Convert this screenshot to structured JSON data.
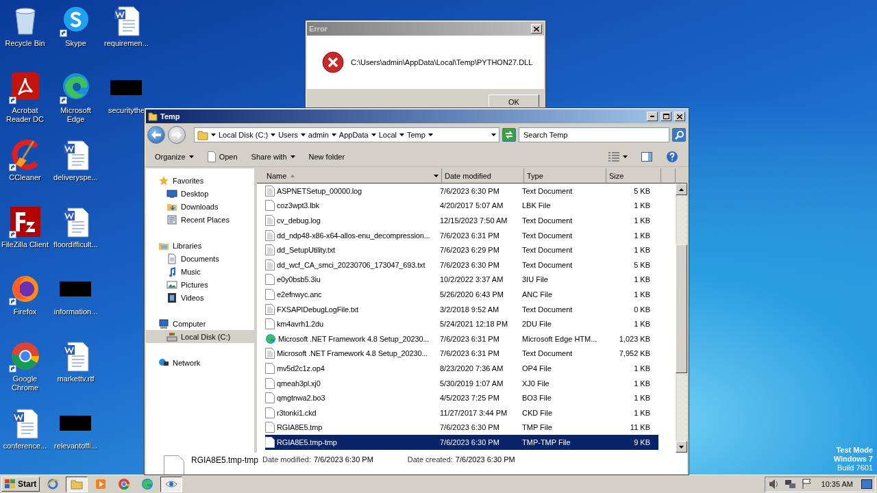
{
  "desktop_icons": [
    {
      "label": "Recycle Bin",
      "kind": "recycle",
      "shortcut": false
    },
    {
      "label": "Acrobat Reader DC",
      "kind": "acrobat",
      "shortcut": true
    },
    {
      "label": "CCleaner",
      "kind": "ccleaner",
      "shortcut": true
    },
    {
      "label": "FileZilla Client",
      "kind": "filezilla",
      "shortcut": true
    },
    {
      "label": "Firefox",
      "kind": "firefox",
      "shortcut": true
    },
    {
      "label": "Google Chrome",
      "kind": "chrome",
      "shortcut": true
    },
    {
      "label": "conference...",
      "kind": "word",
      "shortcut": false
    },
    {
      "label": "Skype",
      "kind": "skype",
      "shortcut": true
    },
    {
      "label": "Microsoft Edge",
      "kind": "edge",
      "shortcut": true
    },
    {
      "label": "deliveryspe...",
      "kind": "word",
      "shortcut": false
    },
    {
      "label": "floordifficult...",
      "kind": "word",
      "shortcut": false
    },
    {
      "label": "information...",
      "kind": "blackout",
      "shortcut": false
    },
    {
      "label": "markettv.rtf",
      "kind": "word",
      "shortcut": false
    },
    {
      "label": "relevantoffi...",
      "kind": "blackout",
      "shortcut": false
    },
    {
      "label": "requiremen...",
      "kind": "word",
      "shortcut": false
    },
    {
      "label": "securitythe",
      "kind": "blackout",
      "shortcut": false
    }
  ],
  "error_dialog": {
    "title": "Error",
    "message": "C:\\Users\\admin\\AppData\\Local\\Temp\\PYTHON27.DLL",
    "button": "OK"
  },
  "explorer": {
    "title": "Temp",
    "breadcrumb": [
      "Local Disk (C:)",
      "Users",
      "admin",
      "AppData",
      "Local",
      "Temp"
    ],
    "search": {
      "placeholder": "Search Temp"
    },
    "toolbar": [
      {
        "label": "Organize",
        "kind": "menu"
      },
      {
        "label": "Open",
        "kind": "open"
      },
      {
        "label": "Share with",
        "kind": "menu"
      },
      {
        "label": "New folder",
        "kind": "plain"
      }
    ],
    "nav": [
      {
        "label": "Favorites",
        "kind": "favorites",
        "selected": false,
        "children": [
          {
            "label": "Desktop",
            "kind": "desktop",
            "selected": false
          },
          {
            "label": "Downloads",
            "kind": "downloads",
            "selected": false
          },
          {
            "label": "Recent Places",
            "kind": "recent",
            "selected": false
          }
        ]
      },
      {
        "label": "Libraries",
        "kind": "libraries",
        "selected": false,
        "children": [
          {
            "label": "Documents",
            "kind": "documents",
            "selected": false
          },
          {
            "label": "Music",
            "kind": "music",
            "selected": false
          },
          {
            "label": "Pictures",
            "kind": "pictures",
            "selected": false
          },
          {
            "label": "Videos",
            "kind": "videos",
            "selected": false
          }
        ]
      },
      {
        "label": "Computer",
        "kind": "computer",
        "selected": false,
        "children": [
          {
            "label": "Local Disk (C:)",
            "kind": "disk",
            "selected": true
          }
        ]
      },
      {
        "label": "Network",
        "kind": "network",
        "selected": false
      }
    ],
    "columns": [
      "Name",
      "Date modified",
      "Type",
      "Size"
    ],
    "files": [
      {
        "name": "ASPNETSetup_00000.log",
        "date": "7/6/2023 6:30 PM",
        "type": "Text Document",
        "size": "5 KB",
        "kind": "text",
        "selected": false
      },
      {
        "name": "coz3wpt3.lbk",
        "date": "4/20/2017 5:07 AM",
        "type": "LBK File",
        "size": "1 KB",
        "kind": "blank",
        "selected": false
      },
      {
        "name": "cv_debug.log",
        "date": "12/15/2023 7:50 AM",
        "type": "Text Document",
        "size": "1 KB",
        "kind": "text",
        "selected": false
      },
      {
        "name": "dd_ndp48-x86-x64-allos-enu_decompression...",
        "date": "7/6/2023 6:31 PM",
        "type": "Text Document",
        "size": "1 KB",
        "kind": "text",
        "selected": false
      },
      {
        "name": "dd_SetupUtility.txt",
        "date": "7/6/2023 6:29 PM",
        "type": "Text Document",
        "size": "1 KB",
        "kind": "text",
        "selected": false
      },
      {
        "name": "dd_wcf_CA_smci_20230706_173047_693.txt",
        "date": "7/6/2023 6:30 PM",
        "type": "Text Document",
        "size": "5 KB",
        "kind": "text",
        "selected": false
      },
      {
        "name": "e0y0bsb5.3iu",
        "date": "10/2/2022 3:37 AM",
        "type": "3IU File",
        "size": "1 KB",
        "kind": "blank",
        "selected": false
      },
      {
        "name": "e2efnwyc.anc",
        "date": "5/26/2020 6:43 PM",
        "type": "ANC File",
        "size": "1 KB",
        "kind": "blank",
        "selected": false
      },
      {
        "name": "FXSAPIDebugLogFile.txt",
        "date": "3/2/2018 9:52 AM",
        "type": "Text Document",
        "size": "0 KB",
        "kind": "text",
        "selected": false
      },
      {
        "name": "km4avrh1.2du",
        "date": "5/24/2021 12:18 PM",
        "type": "2DU File",
        "size": "1 KB",
        "kind": "blank",
        "selected": false
      },
      {
        "name": "Microsoft .NET Framework 4.8 Setup_20230...",
        "date": "7/6/2023 6:31 PM",
        "type": "Microsoft Edge HTM...",
        "size": "1,023 KB",
        "kind": "edge",
        "selected": false
      },
      {
        "name": "Microsoft .NET Framework 4.8 Setup_20230...",
        "date": "7/6/2023 6:31 PM",
        "type": "Text Document",
        "size": "7,952 KB",
        "kind": "text",
        "selected": false
      },
      {
        "name": "mv5d2c1z.op4",
        "date": "8/23/2020 7:36 AM",
        "type": "OP4 File",
        "size": "1 KB",
        "kind": "blank",
        "selected": false
      },
      {
        "name": "qmeah3pl.xj0",
        "date": "5/30/2019 1:07 AM",
        "type": "XJ0 File",
        "size": "1 KB",
        "kind": "blank",
        "selected": false
      },
      {
        "name": "qmgtnwa2.bo3",
        "date": "4/5/2023 7:25 PM",
        "type": "BO3 File",
        "size": "1 KB",
        "kind": "blank",
        "selected": false
      },
      {
        "name": "r3tonki1.ckd",
        "date": "11/27/2017 3:44 PM",
        "type": "CKD File",
        "size": "1 KB",
        "kind": "blank",
        "selected": false
      },
      {
        "name": "RGIA8E5.tmp",
        "date": "7/6/2023 6:30 PM",
        "type": "TMP File",
        "size": "11 KB",
        "kind": "blank",
        "selected": false
      },
      {
        "name": "RGIA8E5.tmp-tmp",
        "date": "7/6/2023 6:30 PM",
        "type": "TMP-TMP File",
        "size": "9 KB",
        "kind": "blank",
        "selected": true
      }
    ],
    "details": {
      "name": "RGIA8E5.tmp-tmp",
      "fields": [
        {
          "label": "Date modified:",
          "value": "7/6/2023 6:30 PM"
        },
        {
          "label": "Date created:",
          "value": "7/6/2023 6:30 PM"
        }
      ]
    }
  },
  "os_notice": [
    "Test Mode",
    "Windows 7",
    "Build 7601"
  ],
  "taskbar": {
    "start": "Start",
    "items": [
      {
        "kind": "ie",
        "selected": false
      },
      {
        "kind": "explorer",
        "selected": true
      },
      {
        "kind": "media",
        "selected": false
      },
      {
        "kind": "chrome",
        "selected": false
      },
      {
        "kind": "edge",
        "selected": false
      },
      {
        "kind": "eye",
        "selected": true
      }
    ],
    "tray": [
      {
        "kind": "speaker"
      },
      {
        "kind": "network"
      },
      {
        "kind": "flag"
      }
    ],
    "clock": "10:35 AM"
  }
}
